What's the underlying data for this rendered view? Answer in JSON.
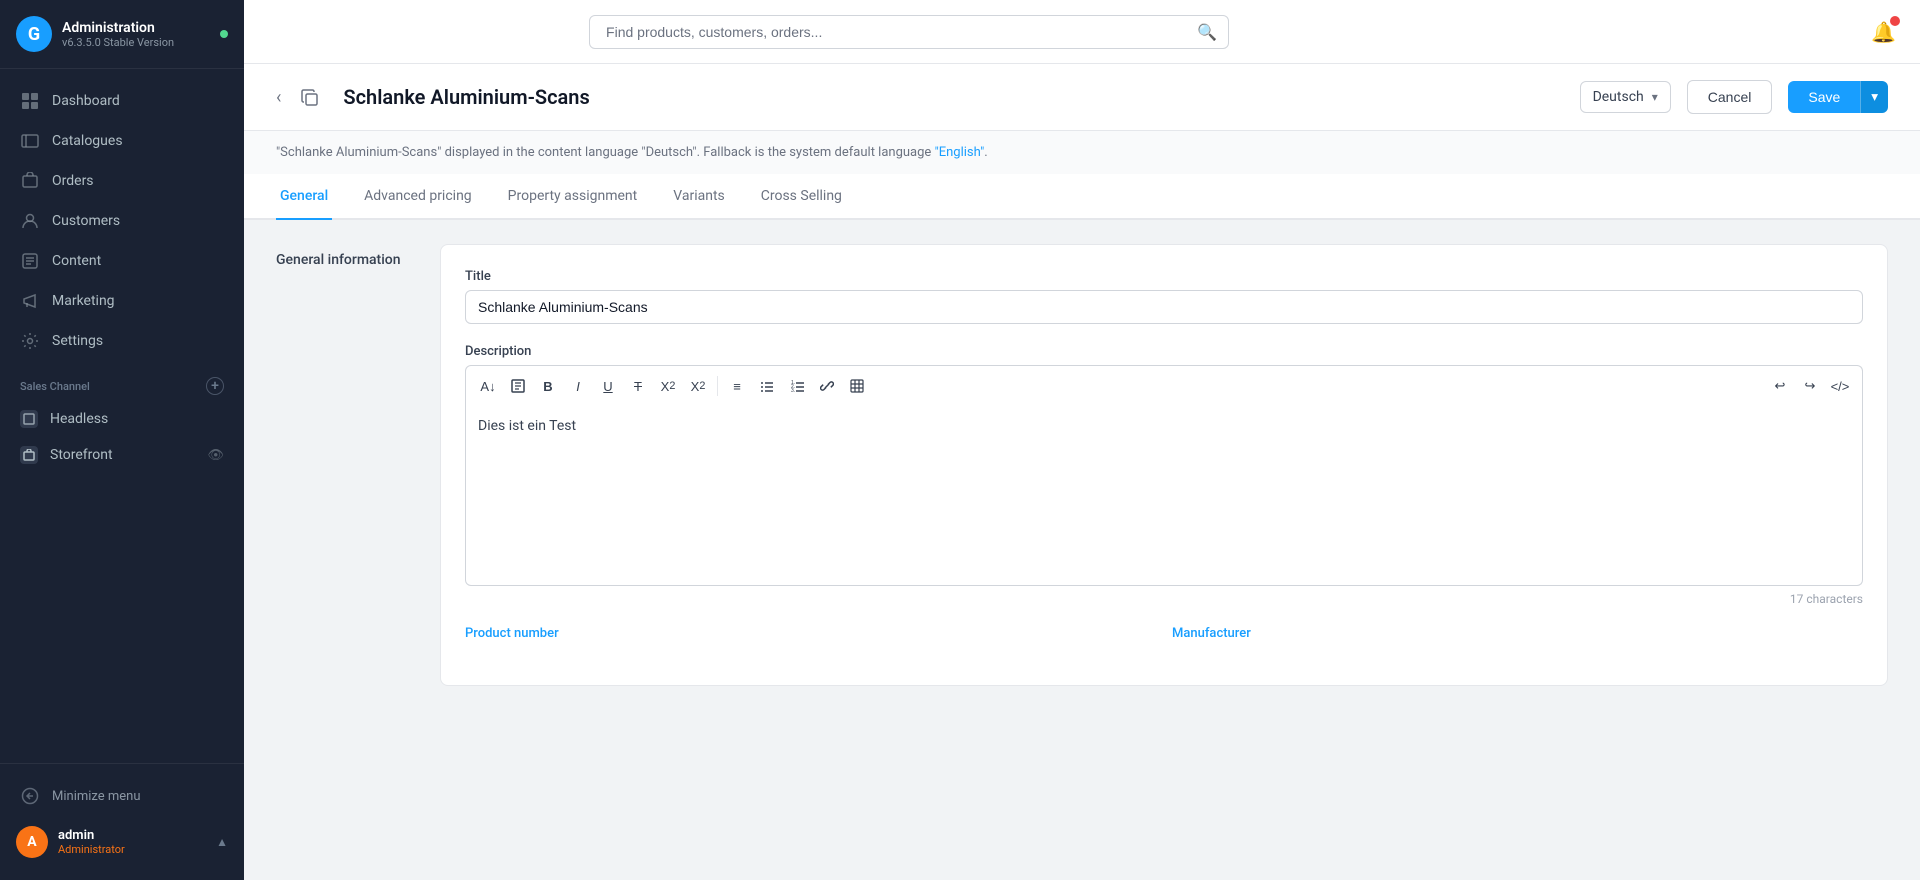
{
  "app": {
    "title": "Administration",
    "version": "v6.3.5.0 Stable Version",
    "logo_letter": "G"
  },
  "sidebar": {
    "nav_items": [
      {
        "id": "dashboard",
        "label": "Dashboard",
        "icon": "grid"
      },
      {
        "id": "catalogues",
        "label": "Catalogues",
        "icon": "tag"
      },
      {
        "id": "orders",
        "label": "Orders",
        "icon": "bag"
      },
      {
        "id": "customers",
        "label": "Customers",
        "icon": "people"
      },
      {
        "id": "content",
        "label": "Content",
        "icon": "doc"
      },
      {
        "id": "marketing",
        "label": "Marketing",
        "icon": "megaphone"
      },
      {
        "id": "settings",
        "label": "Settings",
        "icon": "gear"
      }
    ],
    "sales_channel_label": "Sales Channel",
    "channels": [
      {
        "id": "headless",
        "label": "Headless",
        "icon": "H"
      },
      {
        "id": "storefront",
        "label": "Storefront",
        "icon": "S",
        "has_eye": true
      }
    ],
    "minimize_label": "Minimize menu",
    "user": {
      "initial": "A",
      "name": "admin",
      "role": "Administrator"
    }
  },
  "topbar": {
    "search_placeholder": "Find products, customers, orders..."
  },
  "header": {
    "title": "Schlanke Aluminium-Scans",
    "language": "Deutsch",
    "cancel_label": "Cancel",
    "save_label": "Save"
  },
  "notice": {
    "text_before": "\"Schlanke Aluminium-Scans\" displayed in the content language \"Deutsch\". Fallback is the system default language ",
    "link_text": "\"English\"",
    "text_after": "."
  },
  "tabs": [
    {
      "id": "general",
      "label": "General",
      "active": true
    },
    {
      "id": "advanced_pricing",
      "label": "Advanced pricing",
      "active": false
    },
    {
      "id": "property_assignment",
      "label": "Property assignment",
      "active": false
    },
    {
      "id": "variants",
      "label": "Variants",
      "active": false
    },
    {
      "id": "cross_selling",
      "label": "Cross Selling",
      "active": false
    }
  ],
  "form": {
    "section_label": "General information",
    "title_label": "Title",
    "title_value": "Schlanke Aluminium-Scans",
    "description_label": "Description",
    "description_content": "Dies ist ein Test",
    "char_count": "17 characters",
    "product_number_label": "Product number",
    "manufacturer_label": "Manufacturer"
  },
  "toolbar": {
    "buttons": [
      "A↓",
      "⊞",
      "B",
      "I",
      "U",
      "T̶",
      "X²",
      "X₂",
      "≡",
      "◉",
      "≡⁻",
      "⊞",
      "🔗",
      "⊞"
    ],
    "right_buttons": [
      "↩",
      "↪",
      "</>"
    ]
  }
}
